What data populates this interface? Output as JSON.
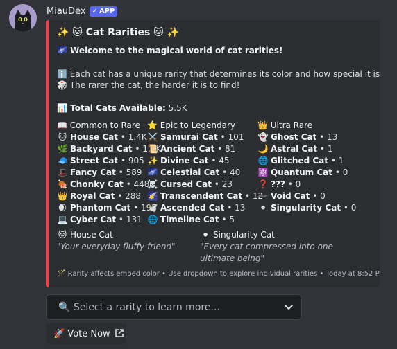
{
  "header": {
    "username": "MiauDex",
    "badge": "APP",
    "badge_check": "✓"
  },
  "embed": {
    "accent_color": "#f23f43",
    "title": "✨ 🐱 Cat Rarities 🐱 ✨",
    "welcome": "🌌 Welcome to the magical world of cat rarities!",
    "info_line_1": "ℹ️ Each cat has a unique rarity that determines its color and how special it is.",
    "info_line_2": "🎲 The rarer the cat, the harder it is to find!",
    "total_label": "📊 Total Cats Available:",
    "total_value": "5.5K",
    "columns": [
      {
        "header": "📖 Common to Rare",
        "rows": [
          {
            "emoji": "🐱",
            "name": "House Cat",
            "count": "1.4K"
          },
          {
            "emoji": "🌿",
            "name": "Backyard Cat",
            "count": "1.1K"
          },
          {
            "emoji": "🧢",
            "name": "Street Cat",
            "count": "905"
          },
          {
            "emoji": "🎩",
            "name": "Fancy Cat",
            "count": "589"
          },
          {
            "emoji": "🍖",
            "name": "Chonky Cat",
            "count": "448"
          },
          {
            "emoji": "👑",
            "name": "Royal Cat",
            "count": "288"
          },
          {
            "emoji": "🌒",
            "name": "Phantom Cat",
            "count": "195"
          },
          {
            "emoji": "💻",
            "name": "Cyber Cat",
            "count": "131"
          }
        ]
      },
      {
        "header": "⭐ Epic to Legendary",
        "rows": [
          {
            "emoji": "⚔️",
            "name": "Samurai Cat",
            "count": "101"
          },
          {
            "emoji": "📜",
            "name": "Ancient Cat",
            "count": "81"
          },
          {
            "emoji": "✨",
            "name": "Divine Cat",
            "count": "45"
          },
          {
            "emoji": "🌌",
            "name": "Celestial Cat",
            "count": "40"
          },
          {
            "emoji": "☠️",
            "name": "Cursed Cat",
            "count": "23"
          },
          {
            "emoji": "🌠",
            "name": "Transcendent Cat",
            "count": "12"
          },
          {
            "emoji": "🕊️",
            "name": "Ascended Cat",
            "count": "13"
          },
          {
            "emoji": "🌐",
            "name": "Timeline Cat",
            "count": "5"
          }
        ]
      },
      {
        "header": "👑 Ultra Rare",
        "rows": [
          {
            "emoji": "👻",
            "name": "Ghost Cat",
            "count": "13"
          },
          {
            "emoji": "🌙",
            "name": "Astral Cat",
            "count": "1"
          },
          {
            "emoji": "🌐",
            "name": "Glitched Cat",
            "count": "1"
          },
          {
            "emoji": "⚛️",
            "name": "Quantum Cat",
            "count": "0"
          },
          {
            "emoji": "❓",
            "name": "???",
            "count": "0"
          },
          {
            "emoji": "➖",
            "name": "Void Cat",
            "count": "0"
          },
          {
            "emoji": "⚫",
            "name": "Singularity Cat",
            "count": "0"
          }
        ]
      }
    ],
    "featured": [
      {
        "emoji": "🐱",
        "name": "House Cat",
        "description": "\"Your everyday fluffy friend\""
      },
      {
        "emoji": "⚫",
        "name": "Singularity Cat",
        "description": "\"Every cat compressed into one ultimate being\""
      }
    ],
    "footer": "🪄 Rarity affects embed color • Use dropdown to explore individual rarities • Today at 8:52 PM"
  },
  "select": {
    "placeholder": "🔍 Select a rarity to learn more..."
  },
  "vote": {
    "label": "🚀 Vote Now"
  }
}
